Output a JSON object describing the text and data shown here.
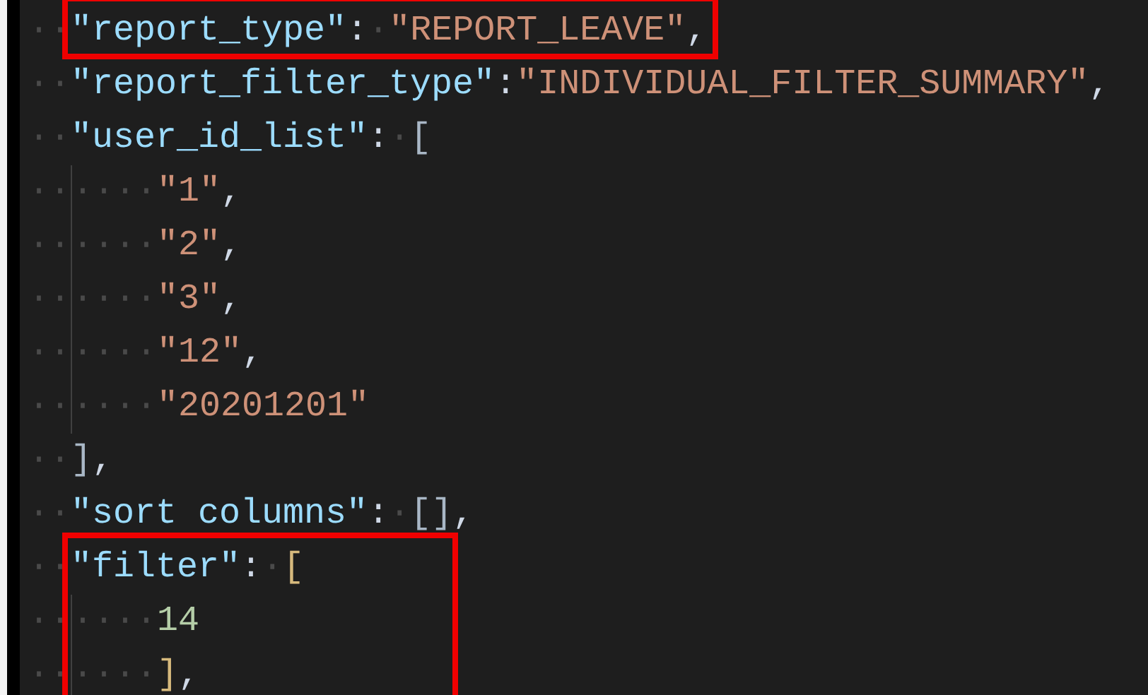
{
  "editor": {
    "blocks": [
      {
        "highlighted": true,
        "lines": [
          {
            "lead": "··",
            "guide": false,
            "tokens": [
              {
                "kind": "key",
                "text": "\"report_type\""
              },
              {
                "kind": "punct",
                "text": ":"
              },
              {
                "kind": "space",
                "text": "·"
              },
              {
                "kind": "string",
                "text": "\"REPORT_LEAVE\""
              },
              {
                "kind": "punct",
                "text": ","
              }
            ]
          }
        ]
      },
      {
        "highlighted": false,
        "lines": [
          {
            "lead": "··",
            "guide": false,
            "tokens": [
              {
                "kind": "key",
                "text": "\"report_filter_type\""
              },
              {
                "kind": "punct",
                "text": ":"
              },
              {
                "kind": "string",
                "text": "\"INDIVIDUAL_FILTER_SUMMARY\""
              },
              {
                "kind": "punct",
                "text": ","
              }
            ]
          },
          {
            "lead": "··",
            "guide": false,
            "tokens": [
              {
                "kind": "key",
                "text": "\"user_id_list\""
              },
              {
                "kind": "punct",
                "text": ":"
              },
              {
                "kind": "space",
                "text": "·"
              },
              {
                "kind": "bracket",
                "text": "[",
                "color": "#a9b7c6"
              }
            ]
          },
          {
            "lead": "··",
            "guide": true,
            "tokens": [
              {
                "kind": "space",
                "text": "····"
              },
              {
                "kind": "string",
                "text": "\"1\""
              },
              {
                "kind": "punct",
                "text": ","
              }
            ]
          },
          {
            "lead": "··",
            "guide": true,
            "tokens": [
              {
                "kind": "space",
                "text": "····"
              },
              {
                "kind": "string",
                "text": "\"2\""
              },
              {
                "kind": "punct",
                "text": ","
              }
            ]
          },
          {
            "lead": "··",
            "guide": true,
            "tokens": [
              {
                "kind": "space",
                "text": "····"
              },
              {
                "kind": "string",
                "text": "\"3\""
              },
              {
                "kind": "punct",
                "text": ","
              }
            ]
          },
          {
            "lead": "··",
            "guide": true,
            "tokens": [
              {
                "kind": "space",
                "text": "····"
              },
              {
                "kind": "string",
                "text": "\"12\""
              },
              {
                "kind": "punct",
                "text": ","
              }
            ]
          },
          {
            "lead": "··",
            "guide": true,
            "tokens": [
              {
                "kind": "space",
                "text": "····"
              },
              {
                "kind": "string",
                "text": "\"20201201\""
              }
            ]
          },
          {
            "lead": "··",
            "guide": false,
            "tokens": [
              {
                "kind": "bracket",
                "text": "]",
                "color": "#a9b7c6"
              },
              {
                "kind": "punct",
                "text": ","
              }
            ]
          },
          {
            "lead": "··",
            "guide": false,
            "tokens": [
              {
                "kind": "key",
                "text": "\"sort columns\""
              },
              {
                "kind": "punct",
                "text": ":"
              },
              {
                "kind": "space",
                "text": "·"
              },
              {
                "kind": "bracket",
                "text": "[]",
                "color": "#a9b7c6"
              },
              {
                "kind": "punct",
                "text": ","
              }
            ]
          }
        ]
      },
      {
        "highlighted": true,
        "lines": [
          {
            "lead": "··",
            "guide": false,
            "tokens": [
              {
                "kind": "key",
                "text": "\"filter\""
              },
              {
                "kind": "punct",
                "text": ":"
              },
              {
                "kind": "space",
                "text": "·"
              },
              {
                "kind": "bracket",
                "text": "[",
                "color": "#d7ba7d"
              }
            ]
          },
          {
            "lead": "··",
            "guide": true,
            "tokens": [
              {
                "kind": "space",
                "text": "····"
              },
              {
                "kind": "number",
                "text": "14"
              }
            ]
          },
          {
            "lead": "··",
            "guide": true,
            "tokens": [
              {
                "kind": "space",
                "text": "····"
              },
              {
                "kind": "bracket",
                "text": "]",
                "color": "#d7ba7d"
              },
              {
                "kind": "punct",
                "text": ","
              }
            ]
          }
        ]
      }
    ]
  }
}
